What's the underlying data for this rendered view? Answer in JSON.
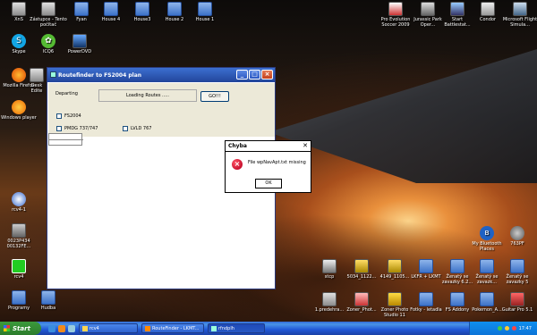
{
  "window": {
    "title": "Routefinder to FS2004 plan",
    "departing_label": "Departing",
    "status_text": "Loading Routes .....",
    "go_label": "GO!!!",
    "checkbox_fs2004": "FS2004",
    "checkbox_pmdg": "PMDG 737/747",
    "checkbox_lvld": "LVLD 767"
  },
  "dialog": {
    "title": "Chyba",
    "message": "File wpNavApt.txt missing",
    "ok_label": "OK"
  },
  "desktop_icons": [
    {
      "label": "XnS"
    },
    {
      "label": "Zástupce - Tento počítač"
    },
    {
      "label": "Fyan"
    },
    {
      "label": "House 4"
    },
    {
      "label": "House3"
    },
    {
      "label": "House 2"
    },
    {
      "label": "House 1"
    },
    {
      "label": "Pro Evolution Soccer 2009"
    },
    {
      "label": "Jurassic Park Oper..."
    },
    {
      "label": "Start Battlestat..."
    },
    {
      "label": "Condor"
    },
    {
      "label": "Microsoft Flight Simula..."
    },
    {
      "label": "Skype"
    },
    {
      "label": "ICQ6"
    },
    {
      "label": "PowerDVD"
    },
    {
      "label": "Mozilla Firefox"
    },
    {
      "label": "Desk Edite"
    },
    {
      "label": "Windows player"
    },
    {
      "label": "rcv4-1"
    },
    {
      "label": "0023P434 00132FE..."
    },
    {
      "label": "rcv4"
    },
    {
      "label": "Programy"
    },
    {
      "label": "Hudba"
    },
    {
      "label": "My Bluetooth Places"
    },
    {
      "label": "763PF"
    },
    {
      "label": "stcp"
    },
    {
      "label": "5034_1122..."
    },
    {
      "label": "4149_1105..."
    },
    {
      "label": "LKFR + LKMT"
    },
    {
      "label": "Ženatý se zavazky 6.2..."
    },
    {
      "label": "Ženatý se zavazk..."
    },
    {
      "label": "Ženatý se zavazky 5"
    },
    {
      "label": "1.predehra..."
    },
    {
      "label": "Zoner_Phot..."
    },
    {
      "label": "Zoner Photo Studio 11"
    },
    {
      "label": "Fotky - letadla"
    },
    {
      "label": "FS Addony"
    },
    {
      "label": "Pokemon_A..."
    },
    {
      "label": "Guitar Pro 5.1"
    }
  ],
  "taskbar": {
    "start_label": "Start",
    "tasks": [
      {
        "label": "rcv4"
      },
      {
        "label": "RouteFinder - LKMT..."
      },
      {
        "label": "rfndplh"
      }
    ],
    "clock": "17:47"
  },
  "colors": {
    "taskbar_blue": "#245edb",
    "start_green": "#3c9a3c",
    "error_red": "#c8102e"
  }
}
